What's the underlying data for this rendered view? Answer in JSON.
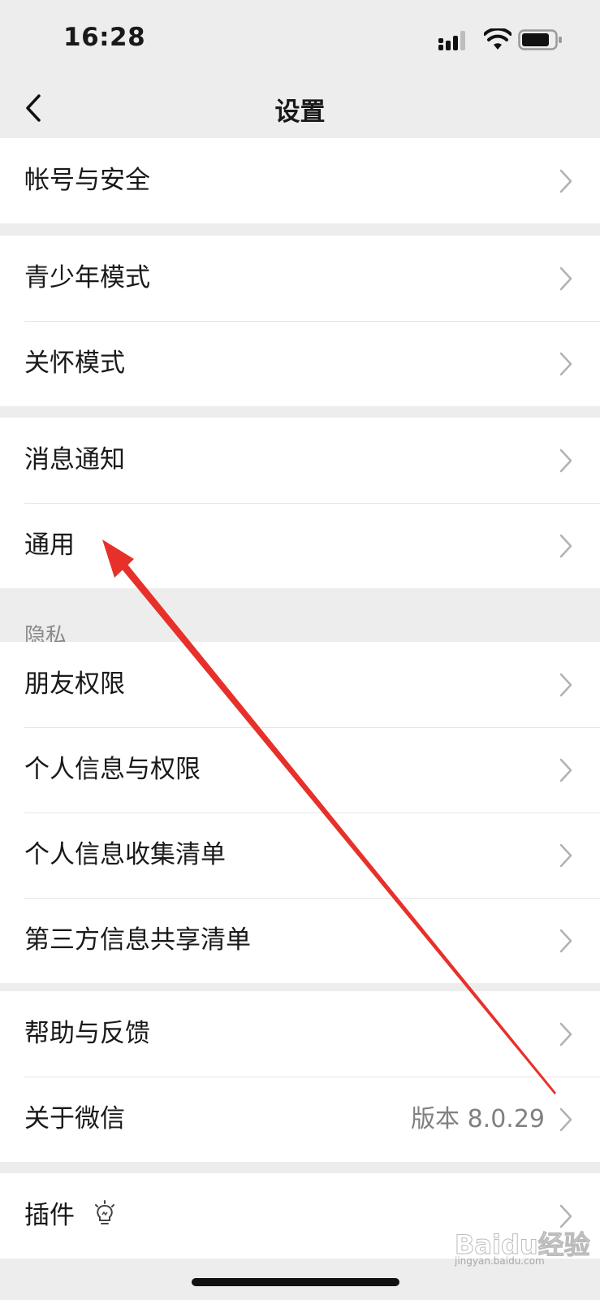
{
  "status_bar": {
    "time": "16:28"
  },
  "nav": {
    "title": "设置"
  },
  "groups": [
    {
      "items": [
        {
          "label": "帐号与安全"
        }
      ]
    },
    {
      "items": [
        {
          "label": "青少年模式"
        },
        {
          "label": "关怀模式"
        }
      ]
    },
    {
      "items": [
        {
          "label": "消息通知"
        },
        {
          "label": "通用"
        }
      ]
    },
    {
      "header": "隐私",
      "items": [
        {
          "label": "朋友权限"
        },
        {
          "label": "个人信息与权限"
        },
        {
          "label": "个人信息收集清单"
        },
        {
          "label": "第三方信息共享清单"
        }
      ]
    },
    {
      "items": [
        {
          "label": "帮助与反馈"
        },
        {
          "label": "关于微信",
          "value": "版本 8.0.29"
        }
      ]
    },
    {
      "items": [
        {
          "label": "插件"
        }
      ]
    }
  ],
  "annotation": {
    "arrow_color": "#e8302a"
  },
  "watermark": {
    "text": "Baidu经验",
    "subtext": "jingyan.baidu.com"
  }
}
